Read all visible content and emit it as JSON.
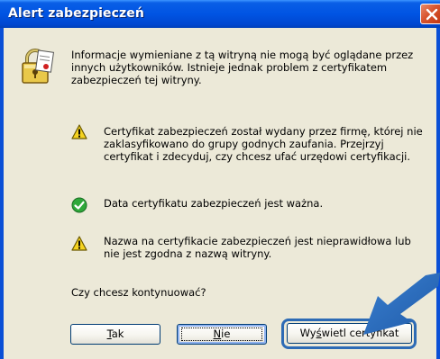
{
  "window": {
    "title": "Alert zabezpieczeń"
  },
  "intro": [
    "Informacje wymieniane z tą witryną nie mogą być oglądane przez",
    "innych użytkowników. Istnieje jednak problem z certyfikatem",
    "zabezpieczeń tej witryny."
  ],
  "messages": {
    "warning1": [
      "Certyfikat zabezpieczeń został wydany przez firmę, której nie",
      "zaklasyfikowano do grupy godnych zaufania. Przejrzyj",
      "certyfikat i zdecyduj, czy chcesz ufać urzędowi certyfikacji."
    ],
    "ok1": [
      "Data certyfikatu zabezpieczeń jest ważna."
    ],
    "warning2": [
      "Nazwa na certyfikacie zabezpieczeń jest nieprawidłowa lub",
      "nie jest zgodna z nazwą witryny."
    ]
  },
  "question": "Czy chcesz kontynuować?",
  "buttons": {
    "yes": {
      "mnemonic": "T",
      "rest": "ak"
    },
    "no": {
      "mnemonic": "N",
      "rest": "ie"
    },
    "view": {
      "before": "Wy",
      "mnemonic": "ś",
      "rest": "wietl certyfikat"
    }
  },
  "colors": {
    "titlebar": "#0054e3",
    "dialog": "#ece9d8",
    "callout": "#2d6bb5"
  },
  "icons": [
    "lock-certificate-icon",
    "warning-icon",
    "check-icon",
    "warning-icon",
    "close-icon",
    "pointer-arrow"
  ]
}
